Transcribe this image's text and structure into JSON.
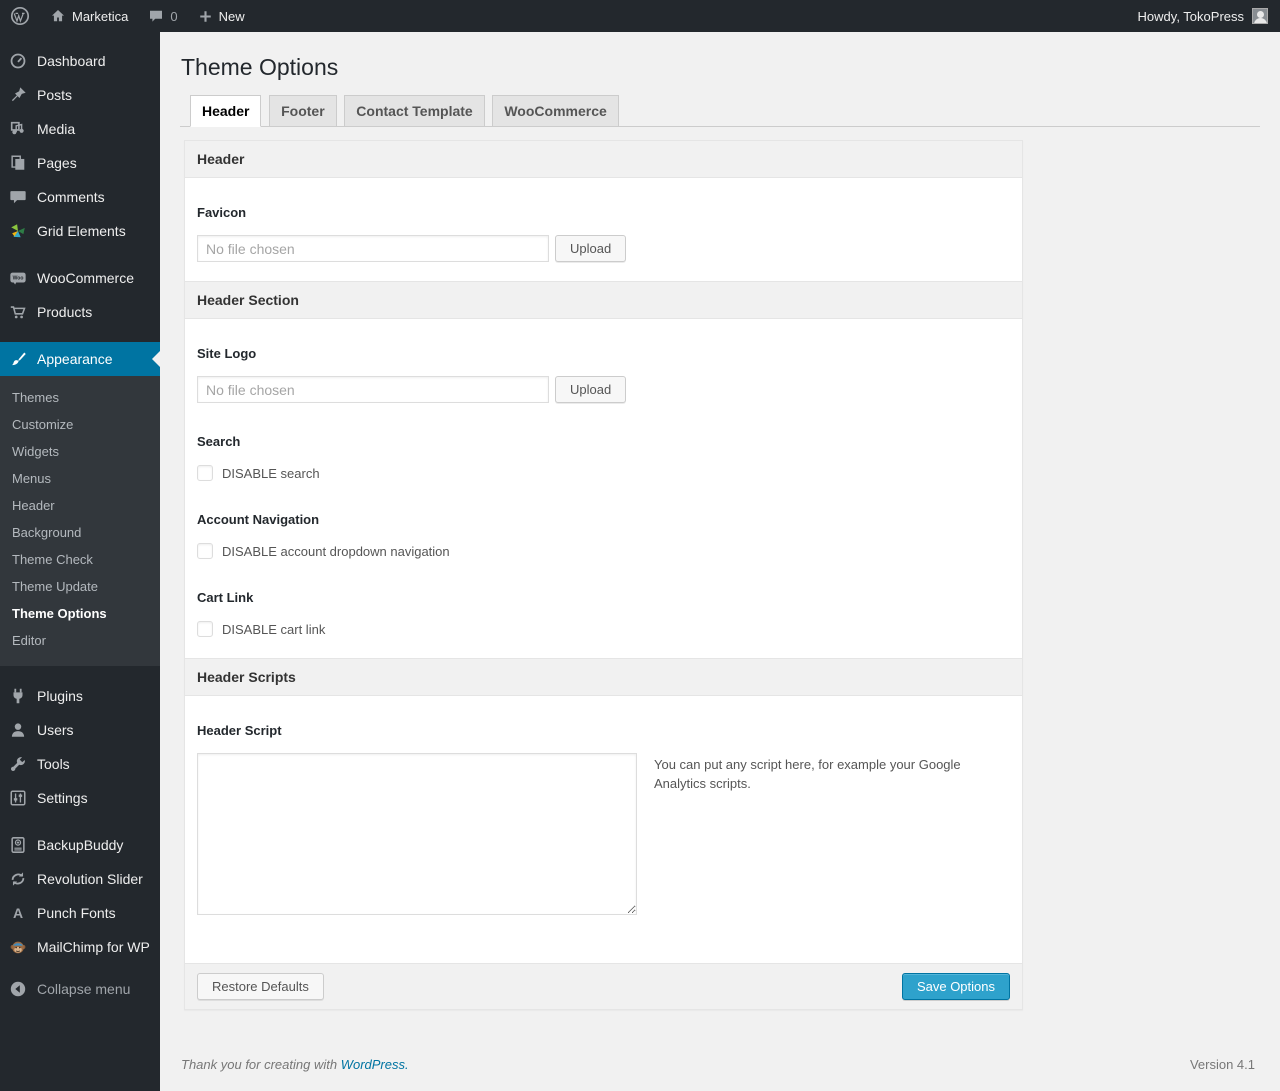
{
  "admin_bar": {
    "site_name": "Marketica",
    "comments_count": "0",
    "new_label": "New",
    "howdy": "Howdy, TokoPress"
  },
  "sidebar": {
    "top_items": [
      {
        "label": "Dashboard",
        "icon": "dashboard-icon"
      },
      {
        "label": "Posts",
        "icon": "pushpin-icon"
      },
      {
        "label": "Media",
        "icon": "media-icon"
      },
      {
        "label": "Pages",
        "icon": "pages-icon"
      },
      {
        "label": "Comments",
        "icon": "comments-icon"
      },
      {
        "label": "Grid Elements",
        "icon": "grid-elements-icon"
      }
    ],
    "commerce_items": [
      {
        "label": "WooCommerce",
        "icon": "woocommerce-icon"
      },
      {
        "label": "Products",
        "icon": "cart-icon"
      }
    ],
    "appearance": {
      "label": "Appearance",
      "icon": "paintbrush-icon",
      "submenu": [
        {
          "label": "Themes"
        },
        {
          "label": "Customize"
        },
        {
          "label": "Widgets"
        },
        {
          "label": "Menus"
        },
        {
          "label": "Header"
        },
        {
          "label": "Background"
        },
        {
          "label": "Theme Check"
        },
        {
          "label": "Theme Update"
        },
        {
          "label": "Theme Options",
          "current": true
        },
        {
          "label": "Editor"
        }
      ]
    },
    "lower_items": [
      {
        "label": "Plugins",
        "icon": "plugin-icon"
      },
      {
        "label": "Users",
        "icon": "user-icon"
      },
      {
        "label": "Tools",
        "icon": "wrench-icon"
      },
      {
        "label": "Settings",
        "icon": "settings-icon"
      }
    ],
    "plugin_items": [
      {
        "label": "BackupBuddy",
        "icon": "backup-drive-icon"
      },
      {
        "label": "Revolution Slider",
        "icon": "refresh-icon"
      },
      {
        "label": "Punch Fonts",
        "icon": "letter-a-icon"
      },
      {
        "label": "MailChimp for WP",
        "icon": "mailchimp-monkey-icon"
      }
    ],
    "collapse_label": "Collapse menu"
  },
  "main": {
    "page_title": "Theme Options",
    "tabs": [
      {
        "label": "Header",
        "active": true
      },
      {
        "label": "Footer"
      },
      {
        "label": "Contact Template"
      },
      {
        "label": "WooCommerce"
      }
    ],
    "section_header": "Header",
    "favicon": {
      "label": "Favicon",
      "value": "No file chosen",
      "upload_label": "Upload"
    },
    "section_header_section": "Header Section",
    "site_logo": {
      "label": "Site Logo",
      "value": "No file chosen",
      "upload_label": "Upload"
    },
    "search": {
      "label": "Search",
      "checkbox_label": "DISABLE search",
      "checked": false
    },
    "account_nav": {
      "label": "Account Navigation",
      "checkbox_label": "DISABLE account dropdown navigation",
      "checked": false
    },
    "cart_link": {
      "label": "Cart Link",
      "checkbox_label": "DISABLE cart link",
      "checked": false
    },
    "section_header_scripts": "Header Scripts",
    "header_script": {
      "label": "Header Script",
      "value": "",
      "description": "You can put any script here, for example your Google Analytics scripts."
    },
    "footer_buttons": {
      "restore": "Restore Defaults",
      "save": "Save Options"
    }
  },
  "footer": {
    "thanks_prefix": "Thank you for creating with ",
    "link_text": "WordPress.",
    "version": "Version 4.1"
  },
  "colors": {
    "accent": "#0074a2",
    "primary_button": "#2ea2cc",
    "menu_bg": "#23282d",
    "submenu_bg": "#32373c",
    "page_bg": "#f1f1f1"
  }
}
